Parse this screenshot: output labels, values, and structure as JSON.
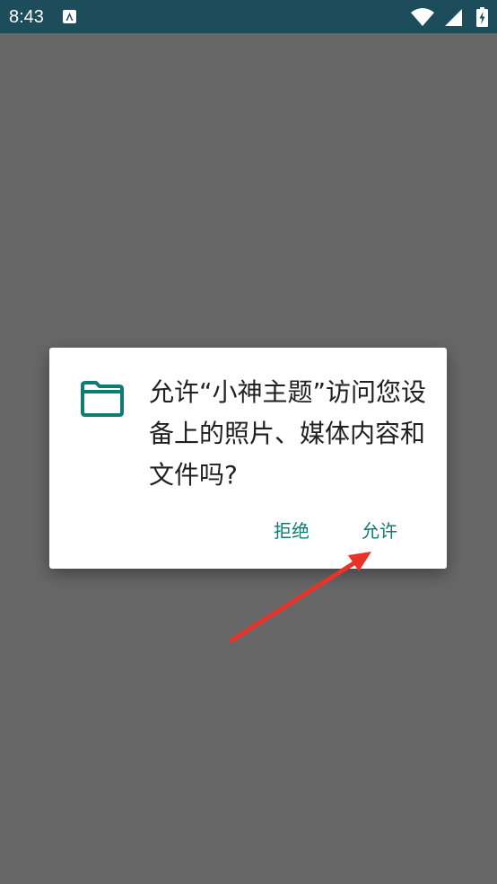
{
  "status_bar": {
    "time": "8:43",
    "notification_icon": "accessibility-notification-icon",
    "icons": [
      "wifi-icon",
      "signal-icon",
      "battery-charging-icon"
    ],
    "background_color": "#1d4c5b"
  },
  "dialog": {
    "icon": "folder-icon",
    "icon_color": "#0d7d72",
    "message": "允许“小神主题”访问您设备上的照片、媒体内容和文件吗?",
    "deny_label": "拒绝",
    "allow_label": "允许",
    "button_color": "#0d7d72"
  },
  "annotation": {
    "arrow_color": "#e8332a",
    "points_to": "allow_label"
  },
  "overlay_color": "#676767"
}
